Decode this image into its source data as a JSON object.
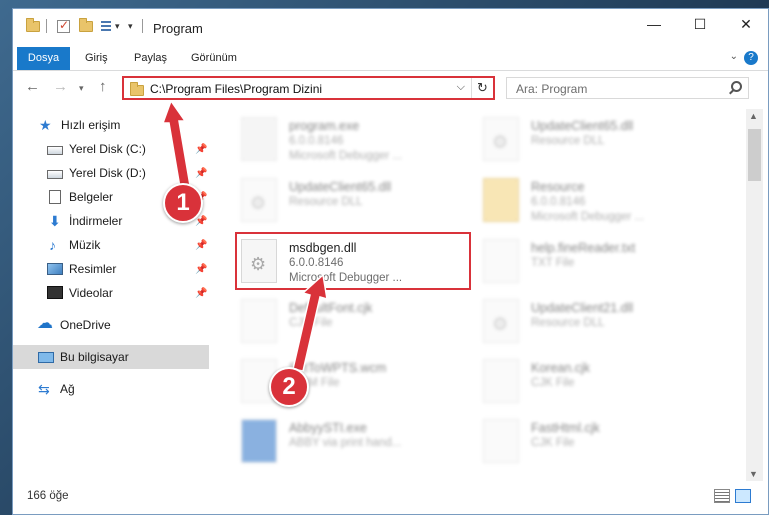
{
  "window": {
    "title": "Program",
    "minimize": "—",
    "maximize": "☐",
    "close": "✕"
  },
  "ribbon": {
    "tabs": [
      "Dosya",
      "Giriş",
      "Paylaş",
      "Görünüm"
    ],
    "help": "?"
  },
  "address": {
    "path": "C:\\Program Files\\Program Dizini",
    "search_placeholder": "Ara: Program"
  },
  "sidebar": {
    "quick_access": "Hızlı erişim",
    "items": [
      {
        "label": "Yerel Disk (C:)",
        "pinned": true
      },
      {
        "label": "Yerel Disk (D:)",
        "pinned": true
      },
      {
        "label": "Belgeler",
        "pinned": true
      },
      {
        "label": "İndirmeler",
        "pinned": true
      },
      {
        "label": "Müzik",
        "pinned": true
      },
      {
        "label": "Resimler",
        "pinned": true
      },
      {
        "label": "Videolar",
        "pinned": true
      }
    ],
    "onedrive": "OneDrive",
    "this_pc": "Bu bilgisayar",
    "network": "Ağ"
  },
  "files": [
    {
      "name": "program.exe",
      "line1": "6.0.0.8146",
      "line2": "Microsoft Debugger ...",
      "kind": "exe",
      "blurred": true
    },
    {
      "name": "UpdateClient65.dll",
      "line1": "Resource DLL",
      "line2": "",
      "kind": "dll",
      "blurred": true
    },
    {
      "name": "UpdateClient65.dll",
      "line1": "Resource DLL",
      "line2": "",
      "kind": "dll",
      "blurred": true
    },
    {
      "name": "Resource",
      "line1": "6.0.0.8146",
      "line2": "Microsoft Debugger ...",
      "kind": "folder",
      "blurred": true
    },
    {
      "name": "msdbgen.dll",
      "line1": "6.0.0.8146",
      "line2": "Microsoft Debugger ...",
      "kind": "dll",
      "blurred": false
    },
    {
      "name": "help.fineReader.txt",
      "line1": "TXT File",
      "line2": "",
      "kind": "txt",
      "blurred": true
    },
    {
      "name": "DefaultFont.cjk",
      "line1": "CJK File",
      "line2": "",
      "kind": "txt",
      "blurred": true
    },
    {
      "name": "UpdateClient21.dll",
      "line1": "Resource DLL",
      "line2": "",
      "kind": "dll",
      "blurred": true
    },
    {
      "name": "SetToWPTS.wcm",
      "line1": "WCM File",
      "line2": "",
      "kind": "txt",
      "blurred": true
    },
    {
      "name": "Korean.cjk",
      "line1": "CJK File",
      "line2": "",
      "kind": "txt",
      "blurred": true
    },
    {
      "name": "AbbyySTI.exe",
      "line1": "ABBY via print hand...",
      "line2": "",
      "kind": "exe",
      "blurred": true
    },
    {
      "name": "FastHtml.cjk",
      "line1": "CJK File",
      "line2": "",
      "kind": "txt",
      "blurred": true
    }
  ],
  "status": {
    "count": "166 öğe"
  },
  "annotations": {
    "badge1": "1",
    "badge2": "2"
  },
  "colors": {
    "accent": "#1979ca",
    "highlight": "#d9323a",
    "selection": "#cce8ff"
  }
}
